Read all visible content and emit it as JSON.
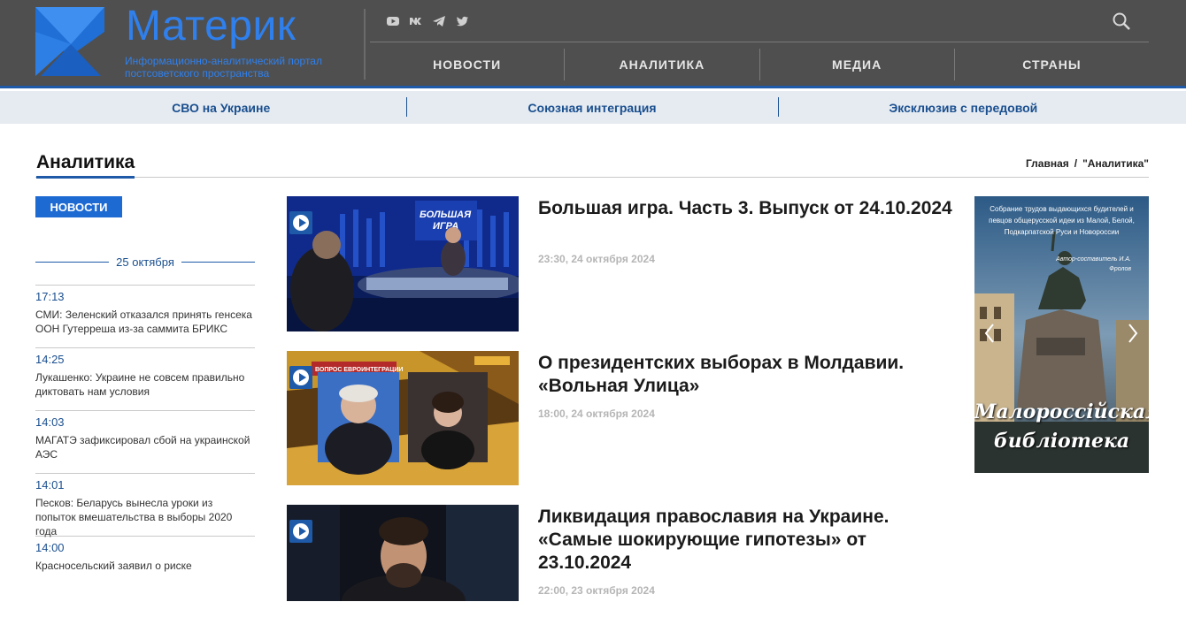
{
  "header": {
    "site_title": "Материк",
    "site_subtitle": "Информационно-аналитический портал постсоветского пространства",
    "socials": [
      "youtube-icon",
      "vk-icon",
      "telegram-icon",
      "twitter-icon"
    ],
    "main_nav": [
      "НОВОСТИ",
      "АНАЛИТИКА",
      "МЕДИА",
      "СТРАНЫ"
    ],
    "brand_color": "#2f80ed"
  },
  "sub_nav": [
    "СВО на Украине",
    "Союзная интеграция",
    "Эксклюзив с передовой"
  ],
  "section": {
    "title": "Аналитика",
    "breadcrumb_home": "Главная",
    "breadcrumb_sep": "/",
    "breadcrumb_current": "\"Аналитика\""
  },
  "feed": {
    "badge": "НОВОСТИ",
    "date": "25 октября",
    "items": [
      {
        "time": "17:13",
        "text": "СМИ: Зеленский отказался принять генсека ООН Гутерреша из-за саммита БРИКС"
      },
      {
        "time": "14:25",
        "text": "Лукашенко: Украине не совсем правильно диктовать нам условия"
      },
      {
        "time": "14:03",
        "text": "МАГАТЭ зафиксировал сбой на украинской АЭС"
      },
      {
        "time": "14:01",
        "text": "Песков: Беларусь вынесла уроки из попыток вмешательства в выборы 2020 года"
      },
      {
        "time": "14:00",
        "text": "Красносельский заявил о риске"
      }
    ]
  },
  "articles": [
    {
      "title": "Большая игра. Часть 3. Выпуск от 24.10.2024",
      "date": "23:30, 24 октября 2024",
      "thumb_text": "БОЛЬШАЯ ИГРА"
    },
    {
      "title": "О президентских выборах в Молдавии. «Вольная Улица»",
      "date": "18:00, 24 октября 2024",
      "thumb_text": "ВОПРОС ЕВРОИНТЕГРАЦИИ"
    },
    {
      "title": "Ликвидация православия на Украине. «Самые шокирующие гипотезы» от 23.10.2024",
      "date": "22:00, 23 октября 2024",
      "thumb_text": ""
    }
  ],
  "banner": {
    "top_text": "Собрание трудов выдающихся будителей и певцов общерусской идеи из Малой, Белой, Подкарпатской Руси и Новороссии",
    "author": "Автор-составитель И.А. Фролов",
    "title_line1": "Малороссiйская",
    "title_line2": "библiотека"
  }
}
